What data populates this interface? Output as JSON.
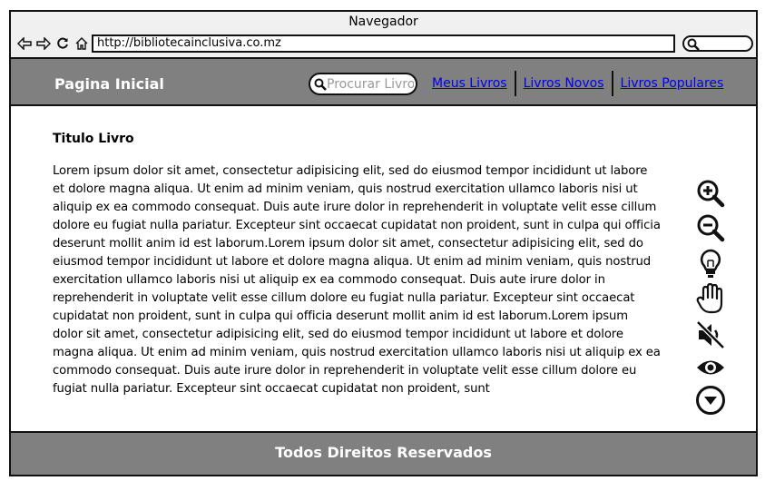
{
  "browser": {
    "window_title": "Navegador",
    "url": "http://bibliotecainclusiva.co.mz",
    "nav_icons": [
      "back-arrow-icon",
      "forward-arrow-icon",
      "reload-icon",
      "home-icon"
    ],
    "search_icon": "search-icon"
  },
  "header": {
    "home_label": "Pagina Inicial",
    "search_placeholder": "Procurar Livro",
    "links": [
      "Meus Livros",
      "Livros Novos",
      "Livros Populares"
    ],
    "background_color": "#808080",
    "link_color": "#0000ee"
  },
  "main": {
    "book_title": "Titulo Livro",
    "book_text": "Lorem ipsum dolor sit amet, consectetur adipisicing elit, sed do eiusmod tempor incididunt ut labore et dolore magna aliqua. Ut enim ad minim veniam, quis nostrud exercitation ullamco laboris nisi ut aliquip ex ea commodo consequat. Duis aute irure dolor in reprehenderit in voluptate velit esse cillum dolore eu fugiat nulla pariatur. Excepteur sint occaecat cupidatat non proident, sunt in culpa qui officia deserunt mollit anim id est laborum.Lorem ipsum dolor sit amet, consectetur adipisicing elit, sed do eiusmod tempor incididunt ut labore et dolore magna aliqua. Ut enim ad minim veniam, quis nostrud exercitation ullamco laboris nisi ut aliquip ex ea commodo consequat. Duis aute irure dolor in reprehenderit in voluptate velit esse cillum dolore eu fugiat nulla pariatur. Excepteur sint occaecat cupidatat non proident, sunt in culpa qui officia deserunt mollit anim id est laborum.Lorem ipsum dolor sit amet, consectetur adipisicing elit, sed do eiusmod tempor incididunt ut labore et dolore magna aliqua. Ut enim ad minim veniam, quis nostrud exercitation ullamco laboris nisi ut aliquip ex ea commodo consequat. Duis aute irure dolor in reprehenderit in voluptate velit esse cillum dolore eu fugiat nulla pariatur. Excepteur sint occaecat cupidatat non proident, sunt"
  },
  "tools": [
    "zoom-in-icon",
    "zoom-out-icon",
    "lightbulb-icon",
    "hand-icon",
    "mute-icon",
    "eye-icon",
    "chevron-down-circle-icon"
  ],
  "footer": {
    "text": "Todos Direitos Reservados"
  }
}
